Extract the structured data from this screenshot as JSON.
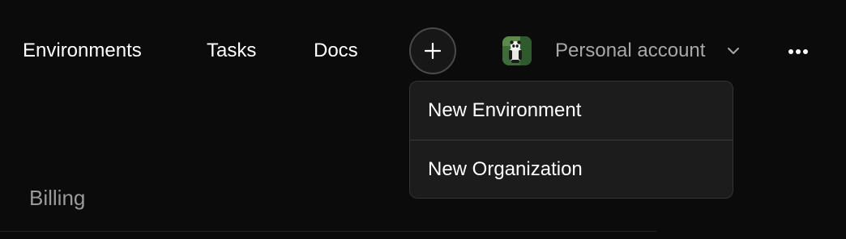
{
  "nav": {
    "links": [
      {
        "label": "Environments"
      },
      {
        "label": "Tasks"
      },
      {
        "label": "Docs"
      }
    ],
    "add_icon": "plus-icon"
  },
  "account": {
    "avatar_icon": "panda-avatar",
    "label": "Personal account",
    "chevron_icon": "chevron-down-icon",
    "more_icon": "more-horizontal-icon"
  },
  "dropdown": {
    "items": [
      {
        "label": "New Environment"
      },
      {
        "label": "New Organization"
      }
    ]
  },
  "page": {
    "section_title": "Billing"
  },
  "colors": {
    "background": "#0b0b0b",
    "menu_background": "#1c1c1c",
    "menu_border": "#333333",
    "primary_text": "#ffffff",
    "muted_text": "#a8a8a8"
  }
}
